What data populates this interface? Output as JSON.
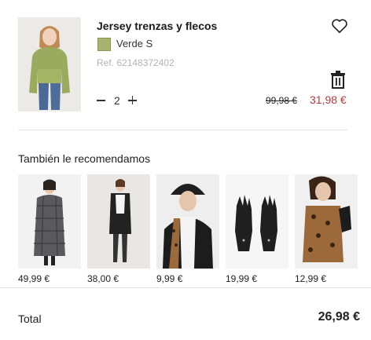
{
  "cart_item": {
    "title": "Jersey trenzas y flecos",
    "color_label": "Verde S",
    "swatch_color": "#a8b370",
    "reference": "Ref. 62148372402",
    "quantity": "2",
    "old_price": "99,98 €",
    "new_price": "31,98 €",
    "sale_color": "#b33b3b",
    "image_icon": "model-green-sweater"
  },
  "recommendations": {
    "title": "También le recomendamos",
    "items": [
      {
        "price": "49,99 €",
        "image": "plaid-coat"
      },
      {
        "price": "38,00 €",
        "image": "long-vest-outfit"
      },
      {
        "price": "9,99 €",
        "image": "rain-hat-leopard-jacket"
      },
      {
        "price": "19,99 €",
        "image": "black-leather-gloves"
      },
      {
        "price": "12,99 €",
        "image": "leopard-scarf-gloves"
      }
    ]
  },
  "summary": {
    "total_label": "Total",
    "total_value": "26,98 €"
  }
}
